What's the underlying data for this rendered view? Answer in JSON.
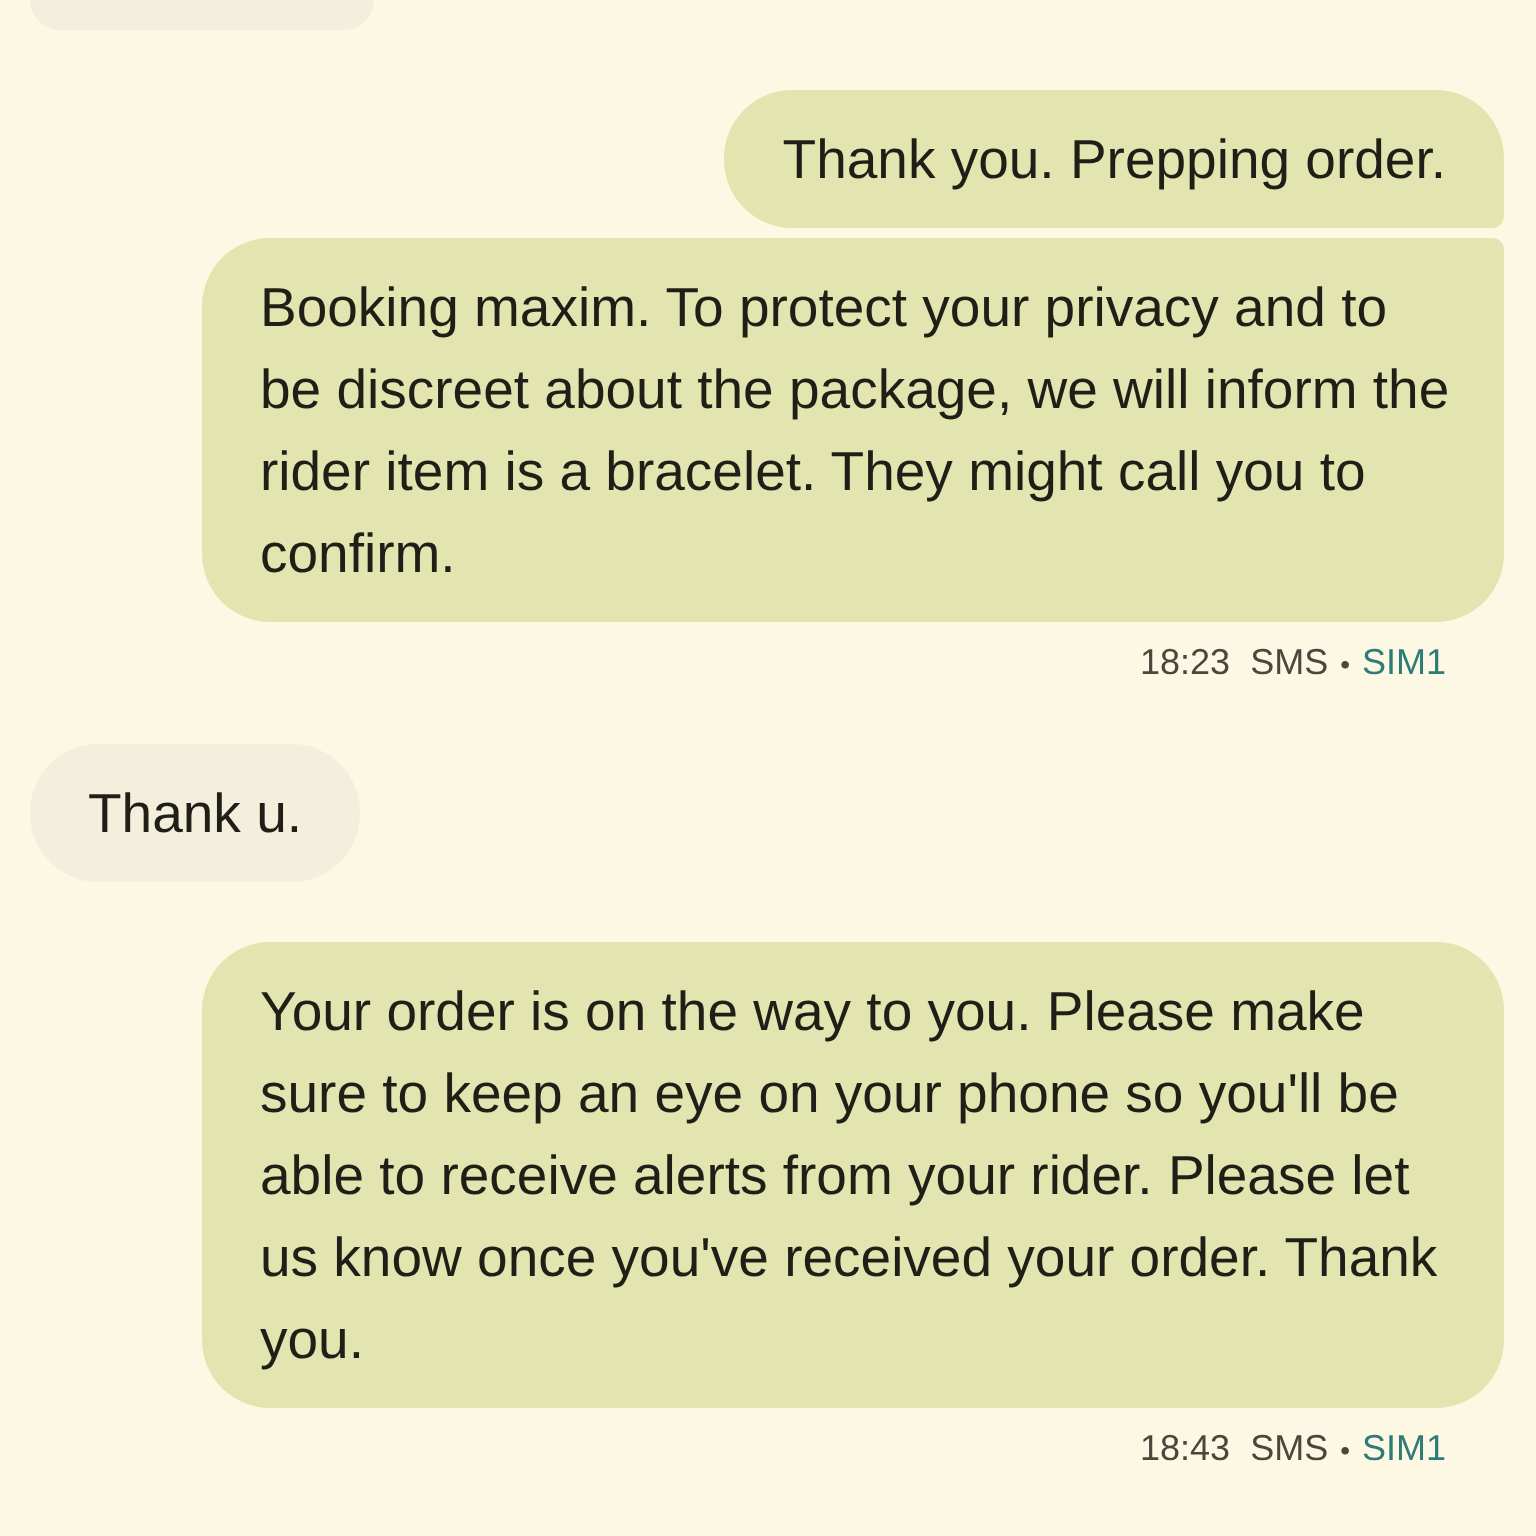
{
  "messages": [
    {
      "kind": "incoming",
      "cut_off": true
    },
    {
      "kind": "outgoing",
      "text": "Thank you. Prepping order."
    },
    {
      "kind": "outgoing",
      "text": "Booking maxim. To protect your privacy and to be discreet about the package, we will inform the rider item is a bracelet. They might call you to confirm.",
      "meta": {
        "time": "18:23",
        "service": "SMS",
        "separator": "•",
        "sim": "SIM1"
      }
    },
    {
      "kind": "incoming",
      "text": "Thank u."
    },
    {
      "kind": "outgoing",
      "text": "Your order is on the way to you. Please make sure to keep an eye on your phone so you'll be able to receive alerts from your rider. Please let us know once you've received your order. Thank you.",
      "meta": {
        "time": "18:43",
        "service": "SMS",
        "separator": "•",
        "sim": "SIM1"
      }
    }
  ]
}
